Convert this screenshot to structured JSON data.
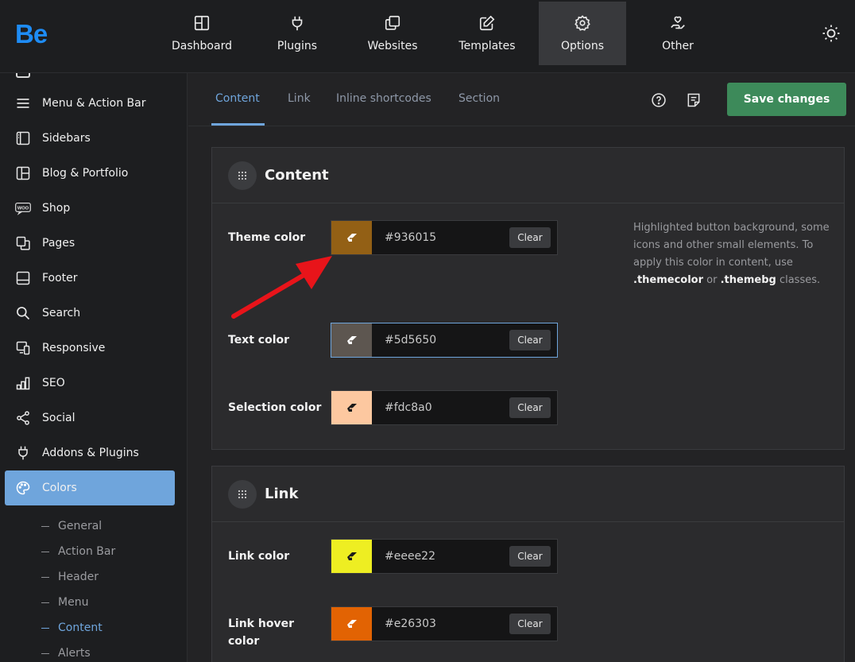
{
  "app": {
    "logo": "Be"
  },
  "topnav": [
    {
      "label": "Dashboard",
      "icon": "dashboard-icon"
    },
    {
      "label": "Plugins",
      "icon": "plug-icon"
    },
    {
      "label": "Websites",
      "icon": "copy-icon"
    },
    {
      "label": "Templates",
      "icon": "template-icon"
    },
    {
      "label": "Options",
      "icon": "gear-icon",
      "active": true
    },
    {
      "label": "Other",
      "icon": "hand-heart-icon"
    }
  ],
  "sidebar": {
    "items": [
      {
        "label": "Menu & Action Bar",
        "icon": "menu-icon"
      },
      {
        "label": "Sidebars",
        "icon": "sidebar-icon"
      },
      {
        "label": "Blog & Portfolio",
        "icon": "layout-icon"
      },
      {
        "label": "Shop",
        "icon": "woo-icon"
      },
      {
        "label": "Pages",
        "icon": "pages-icon"
      },
      {
        "label": "Footer",
        "icon": "footer-icon"
      },
      {
        "label": "Search",
        "icon": "search-icon"
      },
      {
        "label": "Responsive",
        "icon": "responsive-icon"
      },
      {
        "label": "SEO",
        "icon": "seo-icon"
      },
      {
        "label": "Social",
        "icon": "share-icon"
      },
      {
        "label": "Addons & Plugins",
        "icon": "plug-icon"
      },
      {
        "label": "Colors",
        "icon": "palette-icon",
        "active": true
      }
    ],
    "woo_text": "WOO",
    "subitems": [
      {
        "label": "General"
      },
      {
        "label": "Action Bar"
      },
      {
        "label": "Header"
      },
      {
        "label": "Menu"
      },
      {
        "label": "Content",
        "active": true
      },
      {
        "label": "Alerts"
      }
    ]
  },
  "tabs": [
    {
      "label": "Content",
      "active": true
    },
    {
      "label": "Link"
    },
    {
      "label": "Inline shortcodes"
    },
    {
      "label": "Section"
    }
  ],
  "header": {
    "save_label": "Save changes",
    "accent": "#6fa5dc",
    "save_color": "#3d8a5a"
  },
  "panels": {
    "content": {
      "title": "Content",
      "fields": [
        {
          "label": "Theme color",
          "value": "#936015",
          "swatch": "#936015"
        },
        {
          "label": "Text color",
          "value": "#5d5650",
          "swatch": "#5d5650"
        },
        {
          "label": "Selection color",
          "value": "#fdc8a0",
          "swatch": "#fdc8a0"
        }
      ],
      "desc_part1": "Highlighted button background, some icons and other small elements. To apply this color in content, use ",
      "desc_class1": ".themecolor",
      "desc_or": " or ",
      "desc_class2": ".themebg",
      "desc_part2": " classes."
    },
    "link": {
      "title": "Link",
      "fields": [
        {
          "label": "Link color",
          "value": "#eeee22",
          "swatch": "#eeee22"
        },
        {
          "label": "Link hover color",
          "value": "#e26303",
          "swatch": "#e26303"
        }
      ]
    },
    "clear_label": "Clear"
  },
  "annotation": {
    "arrow_color": "#e8141a"
  }
}
